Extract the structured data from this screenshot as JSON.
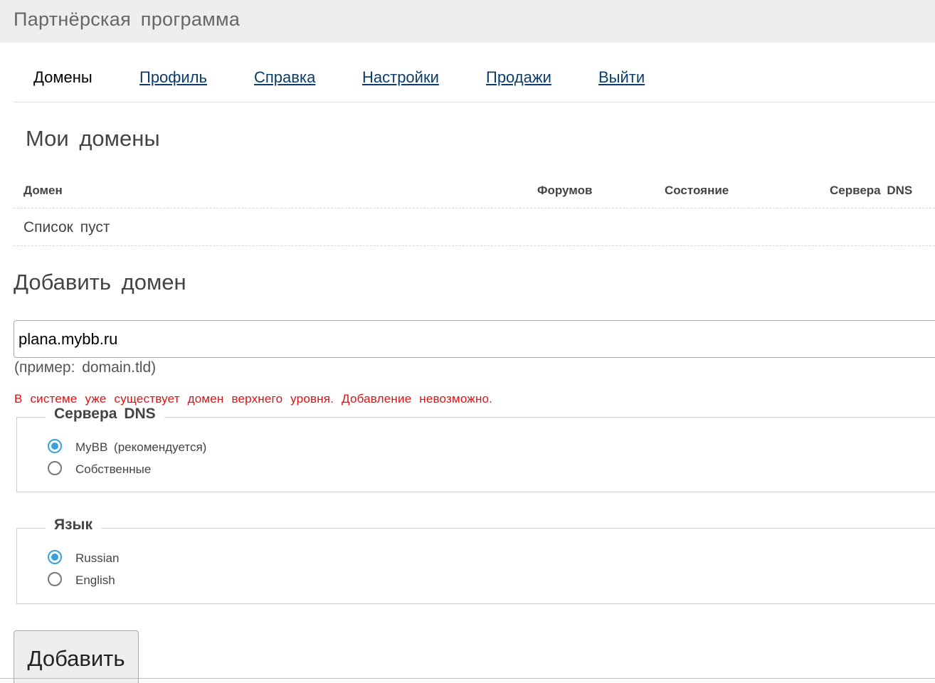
{
  "header": {
    "title": "Партнёрская программа"
  },
  "nav": {
    "items": [
      {
        "label": "Домены",
        "active": true
      },
      {
        "label": "Профиль",
        "active": false
      },
      {
        "label": "Справка",
        "active": false
      },
      {
        "label": "Настройки",
        "active": false
      },
      {
        "label": "Продажи",
        "active": false
      },
      {
        "label": "Выйти",
        "active": false
      }
    ]
  },
  "my_domains": {
    "heading": "Мои домены",
    "columns": [
      "Домен",
      "Форумов",
      "Состояние",
      "Сервера DNS"
    ],
    "empty_text": "Список пуст"
  },
  "add_domain": {
    "heading": "Добавить домен",
    "domain_value": "plana.mybb.ru",
    "hint": "(пример: domain.tld)",
    "error": "В системе уже существует домен верхнего уровня. Добавление невозможно.",
    "dns": {
      "legend": "Сервера DNS",
      "options": [
        {
          "label": "MyBB (рекомендуется)",
          "checked": true
        },
        {
          "label": "Собственные",
          "checked": false
        }
      ]
    },
    "language": {
      "legend": "Язык",
      "options": [
        {
          "label": "Russian",
          "checked": true
        },
        {
          "label": "English",
          "checked": false
        }
      ]
    },
    "submit_label": "Добавить"
  },
  "colors": {
    "link": "#0b3d6b",
    "error": "#e01010",
    "radio_accent": "#3aa0d9",
    "topbar_bg": "#eeeeee"
  }
}
